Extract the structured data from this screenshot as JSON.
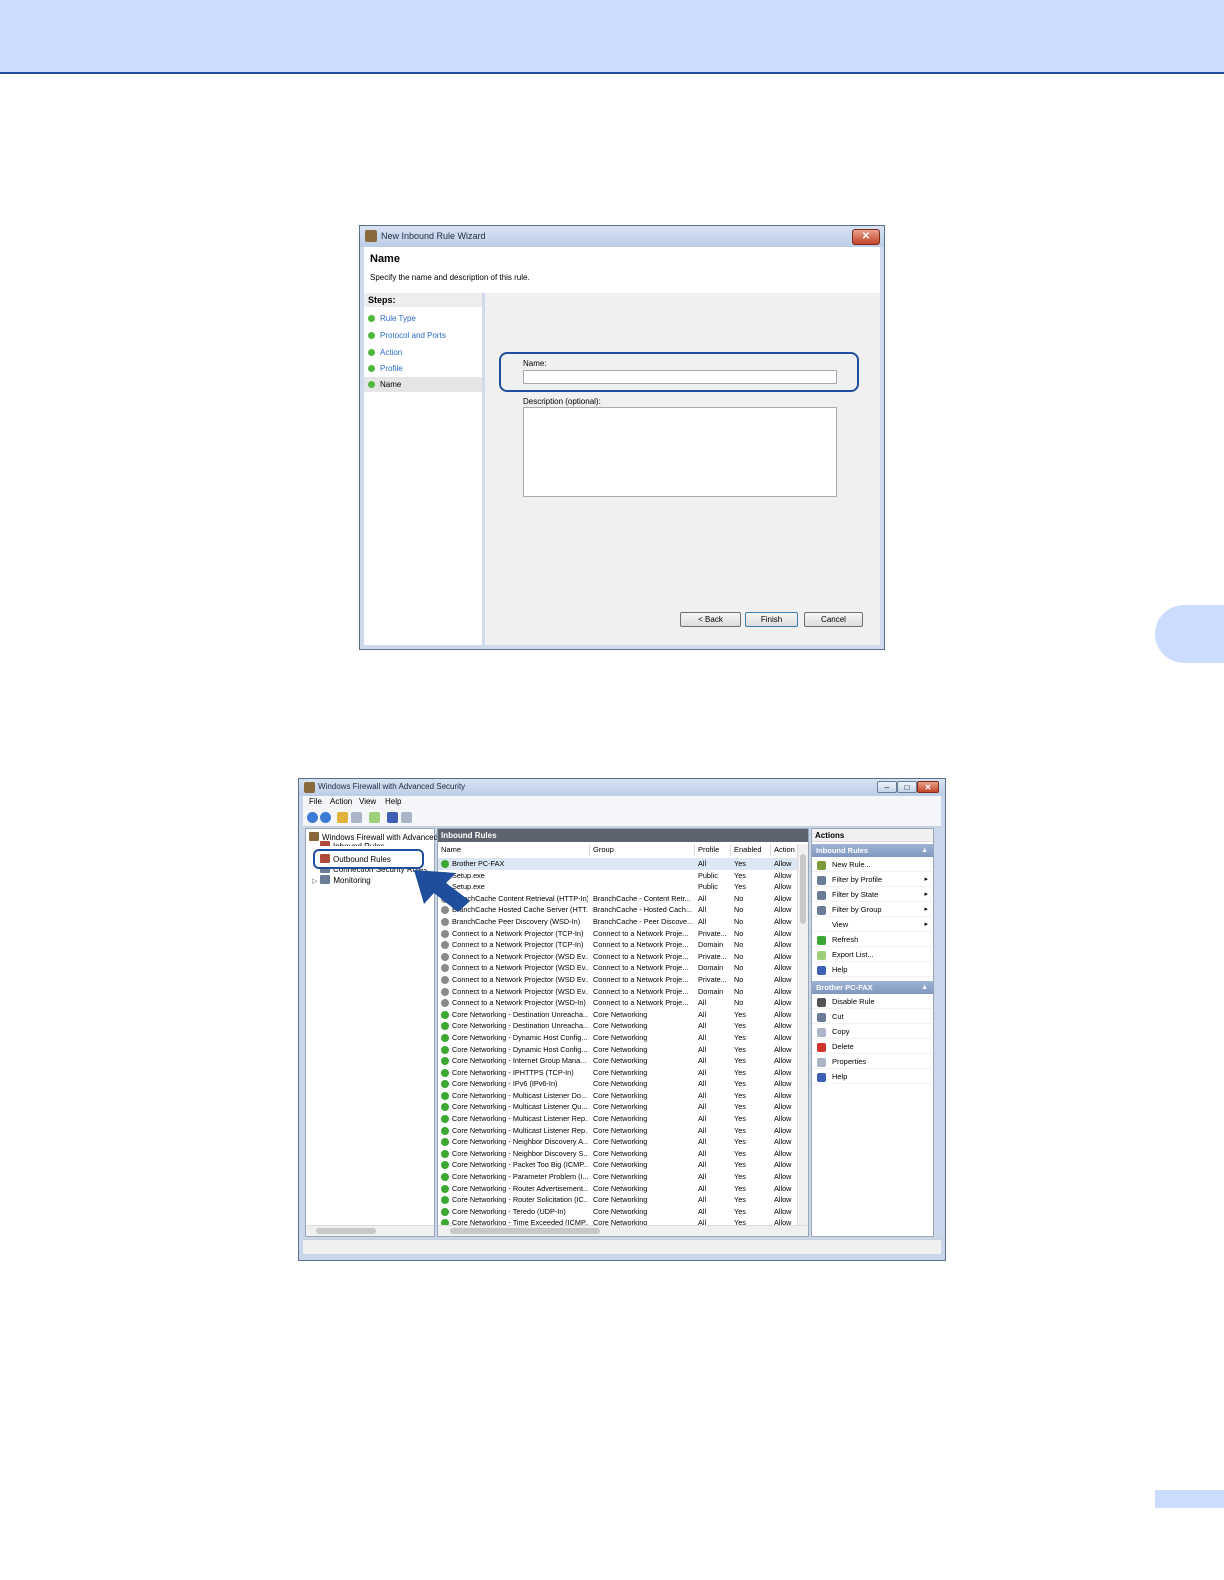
{
  "wizard": {
    "title": "New Inbound Rule Wizard",
    "close": "✕",
    "heading": "Name",
    "subheading": "Specify the name and description of this rule.",
    "steps_label": "Steps:",
    "steps": [
      "Rule Type",
      "Protocol and Ports",
      "Action",
      "Profile",
      "Name"
    ],
    "current_step": "Name",
    "name_label": "Name:",
    "name_value": "",
    "description_label": "Description (optional):",
    "description_value": "",
    "buttons": {
      "back": "< Back",
      "finish": "Finish",
      "cancel": "Cancel"
    }
  },
  "firewall": {
    "title": "Windows Firewall with Advanced Security",
    "menu": [
      "File",
      "Action",
      "View",
      "Help"
    ],
    "tree": {
      "root": "Windows Firewall with Advanced S",
      "inbound": "Inbound Rules",
      "outbound": "Outbound Rules",
      "connection": "Connection Security Rules",
      "monitoring": "Monitoring"
    },
    "grid_title": "Inbound Rules",
    "columns": {
      "name": "Name",
      "group": "Group",
      "profile": "Profile",
      "enabled": "Enabled",
      "action": "Action"
    },
    "rows": [
      {
        "name": "Brother PC-FAX",
        "group": "",
        "profile": "All",
        "enabled": "Yes",
        "action": "Allow",
        "on": true
      },
      {
        "name": "Setup.exe",
        "group": "",
        "profile": "Public",
        "enabled": "Yes",
        "action": "Allow",
        "on": true
      },
      {
        "name": "Setup.exe",
        "group": "",
        "profile": "Public",
        "enabled": "Yes",
        "action": "Allow",
        "on": true
      },
      {
        "name": "BranchCache Content Retrieval (HTTP-In)",
        "group": "BranchCache - Content Retr...",
        "profile": "All",
        "enabled": "No",
        "action": "Allow",
        "on": false
      },
      {
        "name": "BranchCache Hosted Cache Server (HTT...",
        "group": "BranchCache - Hosted Cach...",
        "profile": "All",
        "enabled": "No",
        "action": "Allow",
        "on": false
      },
      {
        "name": "BranchCache Peer Discovery (WSD-In)",
        "group": "BranchCache - Peer Discove...",
        "profile": "All",
        "enabled": "No",
        "action": "Allow",
        "on": false
      },
      {
        "name": "Connect to a Network Projector (TCP-In)",
        "group": "Connect to a Network Proje...",
        "profile": "Private...",
        "enabled": "No",
        "action": "Allow",
        "on": false
      },
      {
        "name": "Connect to a Network Projector (TCP-In)",
        "group": "Connect to a Network Proje...",
        "profile": "Domain",
        "enabled": "No",
        "action": "Allow",
        "on": false
      },
      {
        "name": "Connect to a Network Projector (WSD Ev...",
        "group": "Connect to a Network Proje...",
        "profile": "Private...",
        "enabled": "No",
        "action": "Allow",
        "on": false
      },
      {
        "name": "Connect to a Network Projector (WSD Ev...",
        "group": "Connect to a Network Proje...",
        "profile": "Domain",
        "enabled": "No",
        "action": "Allow",
        "on": false
      },
      {
        "name": "Connect to a Network Projector (WSD Ev...",
        "group": "Connect to a Network Proje...",
        "profile": "Private...",
        "enabled": "No",
        "action": "Allow",
        "on": false
      },
      {
        "name": "Connect to a Network Projector (WSD Ev...",
        "group": "Connect to a Network Proje...",
        "profile": "Domain",
        "enabled": "No",
        "action": "Allow",
        "on": false
      },
      {
        "name": "Connect to a Network Projector (WSD-In)",
        "group": "Connect to a Network Proje...",
        "profile": "All",
        "enabled": "No",
        "action": "Allow",
        "on": false
      },
      {
        "name": "Core Networking - Destination Unreacha...",
        "group": "Core Networking",
        "profile": "All",
        "enabled": "Yes",
        "action": "Allow",
        "on": true
      },
      {
        "name": "Core Networking - Destination Unreacha...",
        "group": "Core Networking",
        "profile": "All",
        "enabled": "Yes",
        "action": "Allow",
        "on": true
      },
      {
        "name": "Core Networking - Dynamic Host Config...",
        "group": "Core Networking",
        "profile": "All",
        "enabled": "Yes",
        "action": "Allow",
        "on": true
      },
      {
        "name": "Core Networking - Dynamic Host Config...",
        "group": "Core Networking",
        "profile": "All",
        "enabled": "Yes",
        "action": "Allow",
        "on": true
      },
      {
        "name": "Core Networking - Internet Group Mana...",
        "group": "Core Networking",
        "profile": "All",
        "enabled": "Yes",
        "action": "Allow",
        "on": true
      },
      {
        "name": "Core Networking - IPHTTPS (TCP-In)",
        "group": "Core Networking",
        "profile": "All",
        "enabled": "Yes",
        "action": "Allow",
        "on": true
      },
      {
        "name": "Core Networking - IPv6 (IPv6-In)",
        "group": "Core Networking",
        "profile": "All",
        "enabled": "Yes",
        "action": "Allow",
        "on": true
      },
      {
        "name": "Core Networking - Multicast Listener Do...",
        "group": "Core Networking",
        "profile": "All",
        "enabled": "Yes",
        "action": "Allow",
        "on": true
      },
      {
        "name": "Core Networking - Multicast Listener Qu...",
        "group": "Core Networking",
        "profile": "All",
        "enabled": "Yes",
        "action": "Allow",
        "on": true
      },
      {
        "name": "Core Networking - Multicast Listener Rep...",
        "group": "Core Networking",
        "profile": "All",
        "enabled": "Yes",
        "action": "Allow",
        "on": true
      },
      {
        "name": "Core Networking - Multicast Listener Rep...",
        "group": "Core Networking",
        "profile": "All",
        "enabled": "Yes",
        "action": "Allow",
        "on": true
      },
      {
        "name": "Core Networking - Neighbor Discovery A...",
        "group": "Core Networking",
        "profile": "All",
        "enabled": "Yes",
        "action": "Allow",
        "on": true
      },
      {
        "name": "Core Networking - Neighbor Discovery S...",
        "group": "Core Networking",
        "profile": "All",
        "enabled": "Yes",
        "action": "Allow",
        "on": true
      },
      {
        "name": "Core Networking - Packet Too Big (ICMP...",
        "group": "Core Networking",
        "profile": "All",
        "enabled": "Yes",
        "action": "Allow",
        "on": true
      },
      {
        "name": "Core Networking - Parameter Problem (I...",
        "group": "Core Networking",
        "profile": "All",
        "enabled": "Yes",
        "action": "Allow",
        "on": true
      },
      {
        "name": "Core Networking - Router Advertisement...",
        "group": "Core Networking",
        "profile": "All",
        "enabled": "Yes",
        "action": "Allow",
        "on": true
      },
      {
        "name": "Core Networking - Router Solicitation (IC...",
        "group": "Core Networking",
        "profile": "All",
        "enabled": "Yes",
        "action": "Allow",
        "on": true
      },
      {
        "name": "Core Networking - Teredo (UDP-In)",
        "group": "Core Networking",
        "profile": "All",
        "enabled": "Yes",
        "action": "Allow",
        "on": true
      },
      {
        "name": "Core Networking - Time Exceeded (ICMP...",
        "group": "Core Networking",
        "profile": "All",
        "enabled": "Yes",
        "action": "Allow",
        "on": true
      }
    ],
    "actions": {
      "header": "Actions",
      "section1": "Inbound Rules",
      "section1_items": [
        {
          "label": "New Rule...",
          "icon": "new-rule-icon",
          "sub": ""
        },
        {
          "label": "Filter by Profile",
          "icon": "filter-icon",
          "sub": "▸"
        },
        {
          "label": "Filter by State",
          "icon": "filter-icon",
          "sub": "▸"
        },
        {
          "label": "Filter by Group",
          "icon": "filter-icon",
          "sub": "▸"
        },
        {
          "label": "View",
          "icon": "",
          "sub": "▸"
        },
        {
          "label": "Refresh",
          "icon": "refresh-icon",
          "sub": ""
        },
        {
          "label": "Export List...",
          "icon": "export-icon",
          "sub": ""
        },
        {
          "label": "Help",
          "icon": "help-icon",
          "sub": ""
        }
      ],
      "section2": "Brother PC-FAX",
      "section2_items": [
        {
          "label": "Disable Rule",
          "icon": "disable-icon"
        },
        {
          "label": "Cut",
          "icon": "cut-icon"
        },
        {
          "label": "Copy",
          "icon": "copy-icon"
        },
        {
          "label": "Delete",
          "icon": "delete-icon"
        },
        {
          "label": "Properties",
          "icon": "properties-icon"
        },
        {
          "label": "Help",
          "icon": "help-icon"
        }
      ]
    }
  },
  "colors": {
    "accent": "#1f4e9c",
    "band": "#ccdcff",
    "enabled": "#3aa832",
    "disabled": "#8a8a8a"
  }
}
